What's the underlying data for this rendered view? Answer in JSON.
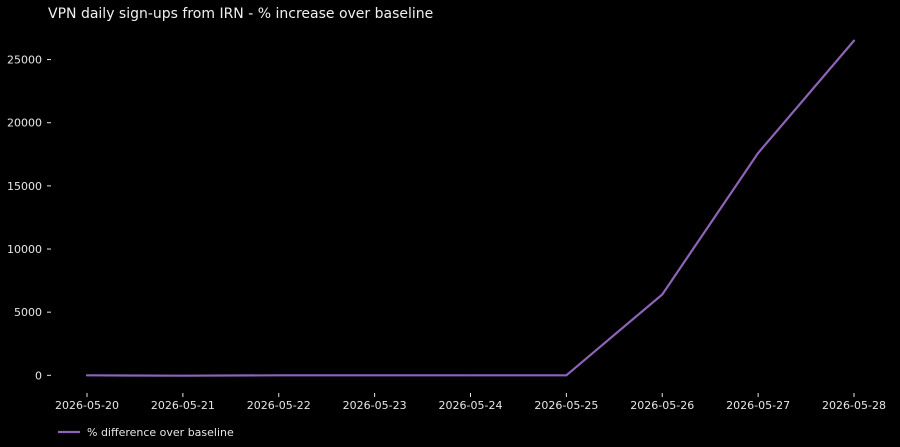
{
  "chart_data": {
    "type": "line",
    "title": "VPN daily sign-ups from IRN - % increase over baseline",
    "xlabel": "",
    "ylabel": "",
    "x": [
      "2026-05-20",
      "2026-05-21",
      "2026-05-22",
      "2026-05-23",
      "2026-05-24",
      "2026-05-25",
      "2026-05-26",
      "2026-05-27",
      "2026-05-28"
    ],
    "series": [
      {
        "name": "% difference over baseline",
        "values": [
          0,
          -30,
          0,
          0,
          0,
          0,
          6400,
          17600,
          26500
        ]
      }
    ],
    "ylim": [
      -1400,
      27500
    ],
    "yticks": [
      0,
      5000,
      10000,
      15000,
      20000,
      25000
    ],
    "grid": false,
    "legend_position": "bottom-left",
    "colors": {
      "background": "#000000",
      "line": "#8e63b8",
      "text": "#e6e6e6"
    }
  }
}
